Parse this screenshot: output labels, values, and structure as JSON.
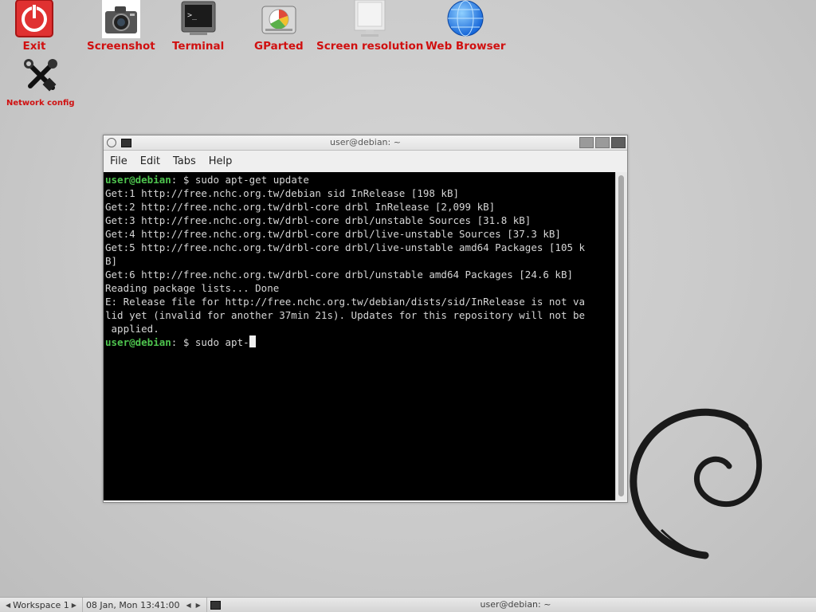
{
  "desktop": {
    "icons": [
      {
        "label": "Exit",
        "icon": "power-icon"
      },
      {
        "label": "Screenshot",
        "icon": "camera-icon"
      },
      {
        "label": "Terminal",
        "icon": "terminal-icon"
      },
      {
        "label": "GParted",
        "icon": "disk-icon"
      },
      {
        "label": "Screen resolution",
        "icon": "monitor-icon"
      },
      {
        "label": "Web Browser",
        "icon": "globe-icon"
      },
      {
        "label": "Network config",
        "icon": "tools-icon"
      }
    ]
  },
  "window": {
    "title": "user@debian: ~",
    "menu": [
      "File",
      "Edit",
      "Tabs",
      "Help"
    ]
  },
  "terminal": {
    "prompt_user": "user@debian",
    "prompt_rest": ": $ ",
    "cmd1": "sudo apt-get update",
    "lines": [
      "Get:1 http://free.nchc.org.tw/debian sid InRelease [198 kB]",
      "Get:2 http://free.nchc.org.tw/drbl-core drbl InRelease [2,099 kB]",
      "Get:3 http://free.nchc.org.tw/drbl-core drbl/unstable Sources [31.8 kB]",
      "Get:4 http://free.nchc.org.tw/drbl-core drbl/live-unstable Sources [37.3 kB]",
      "Get:5 http://free.nchc.org.tw/drbl-core drbl/live-unstable amd64 Packages [105 k",
      "B]",
      "Get:6 http://free.nchc.org.tw/drbl-core drbl/unstable amd64 Packages [24.6 kB]",
      "Reading package lists... Done",
      "E: Release file for http://free.nchc.org.tw/debian/dists/sid/InRelease is not va",
      "lid yet (invalid for another 37min 21s). Updates for this repository will not be",
      " applied."
    ],
    "cmd2": "sudo apt-"
  },
  "taskbar": {
    "workspace": "Workspace 1",
    "datetime": "08 Jan, Mon 13:41:00",
    "task_title": "user@debian: ~"
  }
}
